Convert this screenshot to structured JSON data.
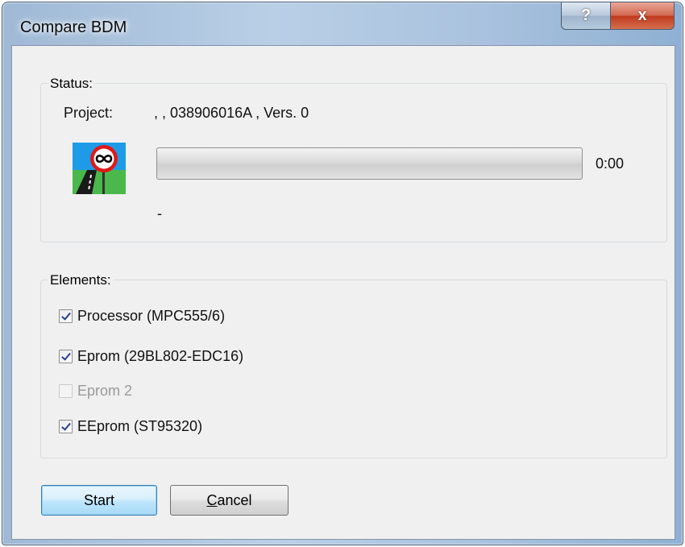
{
  "window": {
    "title": "Compare BDM",
    "help_glyph": "?",
    "close_glyph": "x"
  },
  "status": {
    "group_label": "Status:",
    "project_label": "Project:",
    "project_value": ", , 038906016A , Vers. 0",
    "progress_fraction": 0,
    "elapsed_time": "0:00",
    "status_message": "-",
    "icon": "infinite-road-sign-icon"
  },
  "elements": {
    "group_label": "Elements:",
    "items": [
      {
        "label": "Processor (MPC555/6)",
        "checked": true,
        "enabled": true
      },
      {
        "label": "Eprom (29BL802-EDC16)",
        "checked": true,
        "enabled": true
      },
      {
        "label": "Eprom 2",
        "checked": false,
        "enabled": false
      },
      {
        "label": "EEprom (ST95320)",
        "checked": true,
        "enabled": true
      }
    ]
  },
  "buttons": {
    "start_label": "Start",
    "cancel_label_first": "C",
    "cancel_label_rest": "ancel"
  },
  "colors": {
    "accent_button": "#bee6fd",
    "sign_red": "#e01818",
    "sky_blue": "#1e9be8",
    "grass_green": "#4bb84b"
  }
}
